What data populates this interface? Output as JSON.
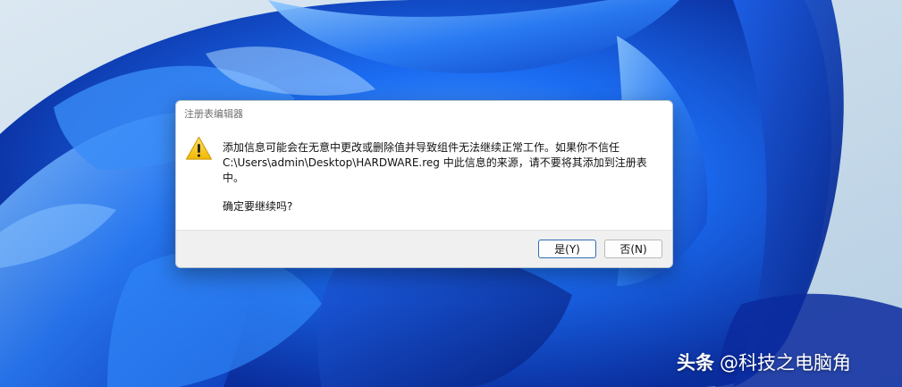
{
  "dialog": {
    "title": "注册表编辑器",
    "message_lines": [
      "添加信息可能会在无意中更改或删除值并导致组件无法继续正常工作。如果你不信任",
      "C:\\Users\\admin\\Desktop\\HARDWARE.reg 中此信息的来源，请不要将其添加到注册表",
      "中。"
    ],
    "question": "确定要继续吗?",
    "icon": "warning-icon",
    "buttons": {
      "yes_label": "是(Y)",
      "no_label": "否(N)"
    }
  },
  "watermark": {
    "brand": "头条",
    "handle": "@科技之电脑角"
  },
  "colors": {
    "wallpaper_light": "#c9dcea",
    "wallpaper_blue": "#1f6ef0",
    "wallpaper_dark": "#0a2a9e",
    "default_button_border": "#2f6db5",
    "warning_yellow": "#f7c61a"
  }
}
